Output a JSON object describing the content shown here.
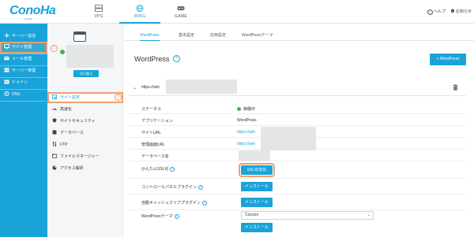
{
  "brand": {
    "logo_text": "ConoHa",
    "logo_sub": "by GMO"
  },
  "topnav": {
    "tabs": [
      {
        "label": "VPS",
        "icon": "server-icon"
      },
      {
        "label": "WING",
        "icon": "globe-icon",
        "active": true
      },
      {
        "label": "GAME",
        "icon": "gamepad-icon"
      }
    ],
    "help_label": "ヘルプ",
    "notice_label": "お知らせ"
  },
  "sidebar": {
    "items": [
      {
        "label": "サーバー追加",
        "icon": "plus-icon"
      },
      {
        "label": "サイト管理",
        "icon": "monitor-icon",
        "active": true
      },
      {
        "label": "メール管理",
        "icon": "mail-icon"
      },
      {
        "label": "サーバー管理",
        "icon": "server-icon"
      },
      {
        "label": "ドメイン",
        "icon": "globe-icon"
      },
      {
        "label": "DNS",
        "icon": "dns-icon"
      }
    ]
  },
  "subsidebar": {
    "switch_label": "切り替え",
    "items": [
      {
        "label": "サイト設定",
        "icon": "settings-icon",
        "active": true
      },
      {
        "label": "高速化",
        "icon": "speed-icon"
      },
      {
        "label": "サイトセキュリティ",
        "icon": "shield-icon"
      },
      {
        "label": "データベース",
        "icon": "database-icon"
      },
      {
        "label": "FTP",
        "icon": "ftp-icon"
      },
      {
        "label": "ファイルマネージャー",
        "icon": "folder-icon"
      },
      {
        "label": "アクセス解析",
        "icon": "pie-chart-icon"
      }
    ]
  },
  "callouts": [
    "1",
    "2",
    "3"
  ],
  "main": {
    "tabs": [
      {
        "label": "WordPress",
        "active": true
      },
      {
        "label": "基本設定"
      },
      {
        "label": "応用設定"
      },
      {
        "label": "WordPressテーマ"
      }
    ],
    "title": "WordPress",
    "add_button": "+ WordPress",
    "site_url_prefix": "https://aim",
    "rows": [
      {
        "label": "ステータス",
        "value": "稼働中"
      },
      {
        "label": "アプリケーション",
        "value": "WordPress"
      },
      {
        "label": "サイトURL",
        "value": "https://aim"
      },
      {
        "label": "管理画面URL",
        "value": "https://aim"
      },
      {
        "label": "データベース名",
        "value": ""
      },
      {
        "label": "かんたんSSL化",
        "button": "SSL有効化"
      },
      {
        "label": "コントロールパネルプラグイン",
        "button": "インストール"
      },
      {
        "label": "自動キャッシュクリアプラグイン",
        "button": "インストール"
      },
      {
        "label": "WordPressテーマ",
        "select": "Cocoon"
      },
      {
        "label": "",
        "button": "インストール"
      }
    ]
  },
  "colors": {
    "accent": "#1aa3d9",
    "highlight": "#f0a070",
    "status_green": "#4caf50"
  }
}
